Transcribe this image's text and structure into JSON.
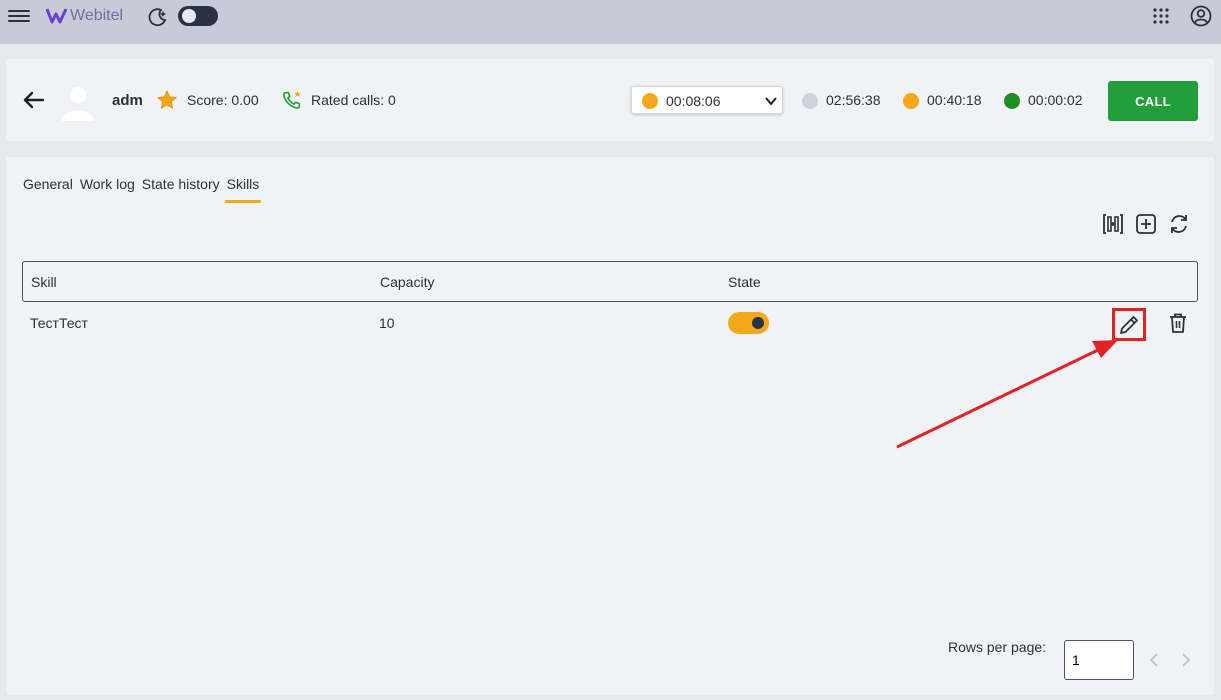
{
  "app": {
    "name": "Webitel"
  },
  "agent": {
    "name": "adm",
    "score": "Score: 0.00",
    "rated_calls": "Rated calls: 0",
    "status_time": "00:08:06",
    "timers": [
      {
        "value": "02:56:38",
        "color": "#cfd1dc"
      },
      {
        "value": "00:40:18",
        "color": "#f3a81c"
      },
      {
        "value": "00:00:02",
        "color": "#1e8f23"
      }
    ],
    "status_color": "#f3a81c",
    "call_label": "CALL"
  },
  "tabs": [
    "General",
    "Work log",
    "State history",
    "Skills"
  ],
  "active_tab": "Skills",
  "table": {
    "columns": [
      "Skill",
      "Capacity",
      "State"
    ],
    "rows": [
      {
        "skill": "ТестТест",
        "capacity": "10",
        "state": true
      }
    ]
  },
  "pagination": {
    "label": "Rows per page:",
    "value": "1"
  },
  "colors": {
    "accent": "#f3a81c",
    "call": "#229f3b",
    "annotation": "#e02424"
  }
}
